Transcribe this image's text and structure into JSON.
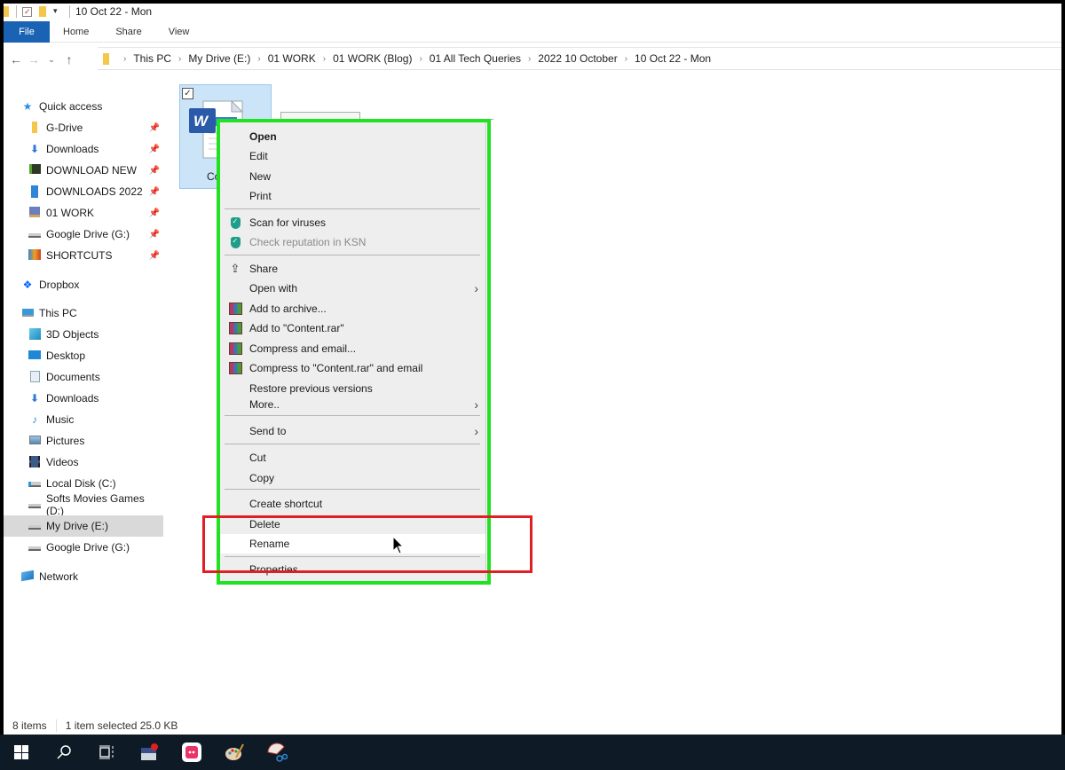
{
  "window": {
    "title": "10 Oct 22 - Mon"
  },
  "ribbon": {
    "tabs": [
      "File",
      "Home",
      "Share",
      "View"
    ]
  },
  "nav": {
    "back": "←",
    "forward": "→",
    "recent": "⌄",
    "up": "↑"
  },
  "breadcrumb": [
    "This PC",
    "My Drive (E:)",
    "01 WORK",
    "01 WORK (Blog)",
    "01 All Tech Queries",
    "2022 10 October",
    "10 Oct 22 - Mon"
  ],
  "sidebar": {
    "quick_access": {
      "label": "Quick access",
      "items": [
        {
          "label": "G-Drive",
          "icon": "folder-icon",
          "pinned": true
        },
        {
          "label": "Downloads",
          "icon": "download-icon",
          "pinned": true
        },
        {
          "label": "DOWNLOAD NEW",
          "icon": "folder-dark-icon",
          "pinned": true
        },
        {
          "label": "DOWNLOADS 2022",
          "icon": "folder-blue-icon",
          "pinned": true
        },
        {
          "label": "01 WORK",
          "icon": "work-folder-icon",
          "pinned": true
        },
        {
          "label": "Google Drive (G:)",
          "icon": "drive-icon",
          "pinned": true
        },
        {
          "label": "SHORTCUTS",
          "icon": "shortcuts-icon",
          "pinned": true
        }
      ]
    },
    "dropbox": "Dropbox",
    "this_pc": {
      "label": "This PC",
      "items": [
        {
          "label": "3D Objects",
          "icon": "3d-objects-icon"
        },
        {
          "label": "Desktop",
          "icon": "desktop-icon"
        },
        {
          "label": "Documents",
          "icon": "documents-icon"
        },
        {
          "label": "Downloads",
          "icon": "download-icon"
        },
        {
          "label": "Music",
          "icon": "music-icon"
        },
        {
          "label": "Pictures",
          "icon": "pictures-icon"
        },
        {
          "label": "Videos",
          "icon": "videos-icon"
        },
        {
          "label": "Local Disk (C:)",
          "icon": "local-disk-icon"
        },
        {
          "label": "Softs Movies Games (D:)",
          "icon": "drive-icon"
        },
        {
          "label": "My Drive (E:)",
          "icon": "drive-icon",
          "selected": true
        },
        {
          "label": "Google Drive (G:)",
          "icon": "drive-icon"
        }
      ]
    },
    "network": "Network"
  },
  "content": {
    "selected_file": {
      "name": "Content",
      "name_visible": "Cont",
      "checked": true
    }
  },
  "context_menu": {
    "items": [
      {
        "label": "Open",
        "bold": true
      },
      {
        "label": "Edit"
      },
      {
        "label": "New"
      },
      {
        "label": "Print"
      },
      {
        "separator": true
      },
      {
        "label": "Scan for viruses",
        "icon": "kaspersky-shield-icon"
      },
      {
        "label": "Check reputation in KSN",
        "icon": "kaspersky-shield-icon",
        "disabled": true
      },
      {
        "separator": true
      },
      {
        "label": "Share",
        "icon": "share-icon"
      },
      {
        "label": "Open with",
        "submenu": true
      },
      {
        "label": "Add to archive...",
        "icon": "winrar-icon"
      },
      {
        "label": "Add to \"Content.rar\"",
        "icon": "winrar-icon"
      },
      {
        "label": "Compress and email...",
        "icon": "winrar-icon"
      },
      {
        "label": "Compress to \"Content.rar\" and email",
        "icon": "winrar-icon"
      },
      {
        "label": "Restore previous versions"
      },
      {
        "label": "More..",
        "submenu": true
      },
      {
        "separator": true
      },
      {
        "label": "Send to",
        "submenu": true
      },
      {
        "separator": true
      },
      {
        "label": "Cut"
      },
      {
        "label": "Copy"
      },
      {
        "separator": true
      },
      {
        "label": "Create shortcut"
      },
      {
        "label": "Delete"
      },
      {
        "label": "Rename",
        "hover": true
      },
      {
        "separator": true
      },
      {
        "label": "Properties"
      }
    ]
  },
  "annotations": {
    "green_box_color": "#22e022",
    "red_box_color": "#e01e24"
  },
  "status_bar": {
    "item_count": "8 items",
    "selection": "1 item selected  25.0 KB"
  },
  "taskbar": {
    "icons": [
      "start-icon",
      "search-icon",
      "task-view-icon",
      "app-window-icon",
      "chat-app-icon",
      "paint-icon",
      "snipping-tool-icon"
    ]
  },
  "colors": {
    "accent": "#1a63b4",
    "selection_bg": "#cce4f7",
    "taskbar_bg": "#0e1a25"
  }
}
